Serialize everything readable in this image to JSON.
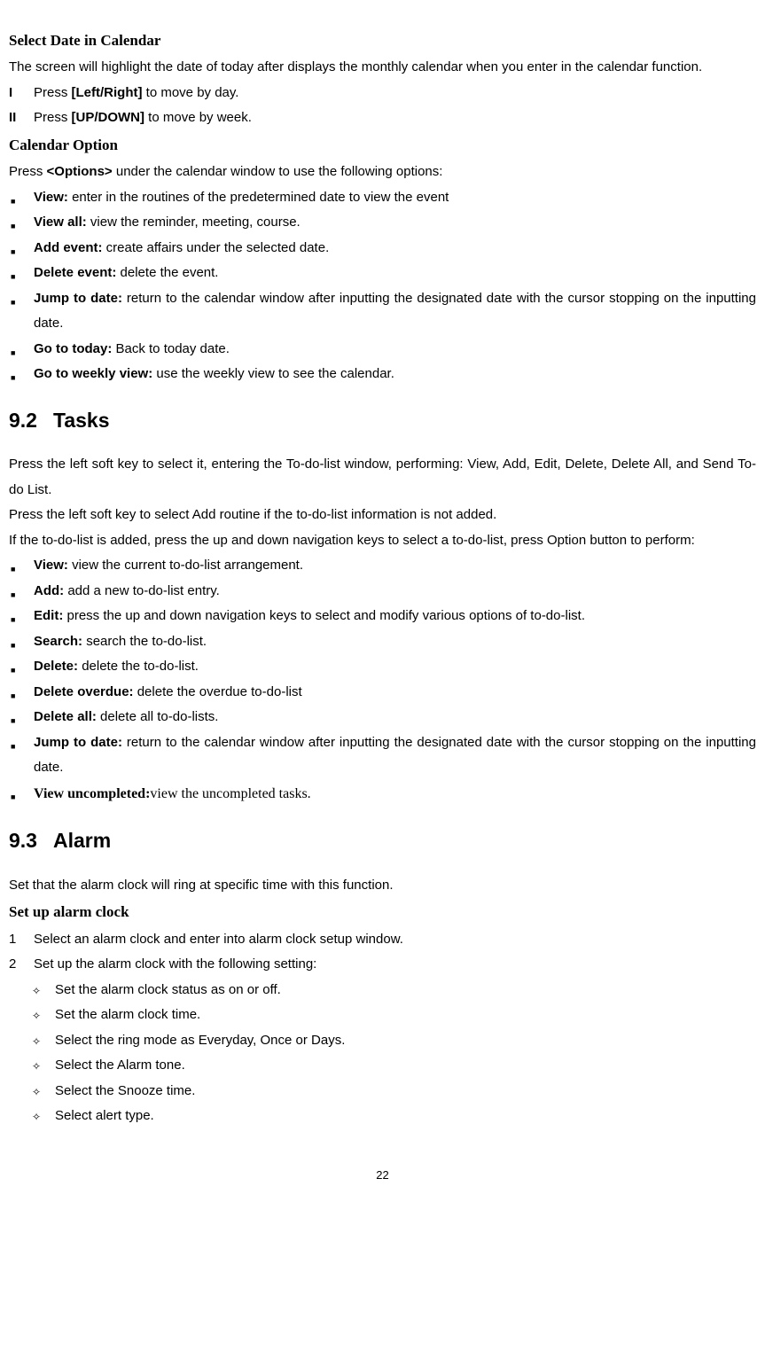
{
  "section1": {
    "heading": "Select Date in Calendar",
    "para": "The screen will highlight the date of today after displays the monthly calendar when you enter in the calendar function.",
    "steps": [
      {
        "marker": "I",
        "pre": "Press ",
        "bold": "[Left/Right]",
        "post": " to move by day."
      },
      {
        "marker": "II",
        "pre": "Press ",
        "bold": "[UP/DOWN]",
        "post": " to move by week."
      }
    ]
  },
  "section2": {
    "heading": "Calendar Option",
    "intro_pre": "Press ",
    "intro_bold": "<Options>",
    "intro_post": " under the calendar window to use the following options:",
    "items": [
      {
        "bold": "View:",
        "text": " enter in the routines of the predetermined date to view the event"
      },
      {
        "bold": "View all:",
        "text": " view the reminder, meeting, course."
      },
      {
        "bold": "Add event:",
        "text": " create affairs under the selected date."
      },
      {
        "bold": "Delete event:",
        "text": " delete the event."
      },
      {
        "bold": "Jump to date:",
        "text": " return to the calendar window after inputting the designated date with the cursor stopping on the inputting date."
      },
      {
        "bold": "Go to today:",
        "text": " Back to today date."
      },
      {
        "bold": "Go to weekly view:",
        "text": " use the weekly view to see the calendar."
      }
    ]
  },
  "section3": {
    "num": "9.2",
    "title": "Tasks",
    "para1": "Press the left soft key to select it, entering the To-do-list window, performing: View, Add, Edit, Delete, Delete All, and Send To-do List.",
    "para2": "Press the left soft key to select Add routine if the to-do-list information is not added.",
    "para3": "If the to-do-list is added, press the up and down navigation keys to select a to-do-list, press Option button to perform:",
    "items": [
      {
        "bold": "View:",
        "text": " view the current to-do-list arrangement."
      },
      {
        "bold": "Add:",
        "text": " add a new to-do-list entry."
      },
      {
        "bold": "Edit:",
        "text": " press the up and down navigation keys to select and modify various options of to-do-list."
      },
      {
        "bold": "Search:",
        "text": " search  the to-do-list."
      },
      {
        "bold": "Delete:",
        "text": " delete the to-do-list."
      },
      {
        "bold": "Delete overdue:",
        "text": " delete the overdue to-do-list"
      },
      {
        "bold": "Delete all:",
        "text": " delete all to-do-lists."
      },
      {
        "bold": "Jump to date:",
        "text": " return to the calendar window after inputting the designated date with the cursor stopping on the inputting date."
      }
    ],
    "serif_item_bold": "View uncompleted:",
    "serif_item_text": "view the uncompleted tasks."
  },
  "section4": {
    "num": "9.3",
    "title": "Alarm",
    "intro": "Set that the alarm clock will ring at specific time with this function.",
    "heading": "Set up alarm clock",
    "steps": [
      {
        "marker": "1",
        "text": "Select an alarm clock and enter into alarm clock setup window."
      },
      {
        "marker": "2",
        "text": "Set up the alarm clock with the following setting:"
      }
    ],
    "subitems": [
      "Set the alarm clock status as on or off.",
      "Set the alarm clock time.",
      "Select the ring mode as Everyday, Once or Days.",
      "Select the Alarm tone.",
      "Select the Snooze time.",
      "Select alert type."
    ]
  },
  "page_number": "22"
}
